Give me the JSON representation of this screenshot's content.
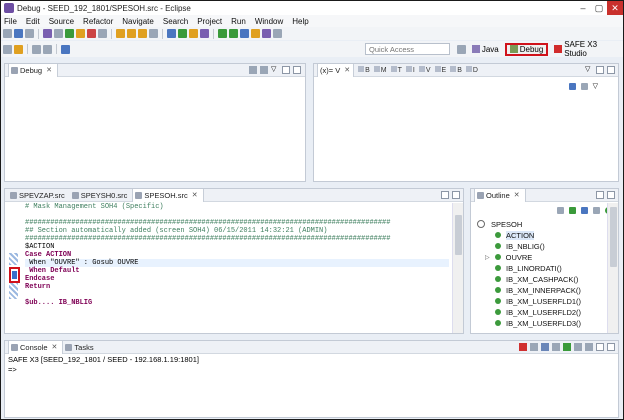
{
  "window": {
    "title": "Debug - SEED_192_1801/SPESOH.src - Eclipse"
  },
  "menu": [
    "File",
    "Edit",
    "Source",
    "Refactor",
    "Navigate",
    "Search",
    "Project",
    "Run",
    "Window",
    "Help"
  ],
  "quick_access": {
    "placeholder": "Quick Access"
  },
  "perspectives": {
    "java": "Java",
    "debug": "Debug",
    "safe": "SAFE X3 Studio"
  },
  "debug_view": {
    "tab": "Debug"
  },
  "variables_view": {
    "tab": "(x)= V",
    "tabs": [
      "B",
      "M",
      "T",
      "I",
      "V",
      "E",
      "B",
      "D"
    ]
  },
  "editor": {
    "tabs": [
      "SPEVZAP.src",
      "SPEYSH0.src",
      "SPESOH.src"
    ],
    "active_tab": "SPESOH.src",
    "lines": [
      {
        "text": "# Mask Management SOH4 (Specific)",
        "style": "comment"
      },
      {
        "text": "",
        "style": ""
      },
      {
        "text": "#######################################################################################",
        "style": "comment"
      },
      {
        "text": "## Section automatically added (screen SOH4) 06/15/2011 14:32:21 (ADMIN)",
        "style": "comment"
      },
      {
        "text": "#######################################################################################",
        "style": "comment"
      },
      {
        "text": "$ACTION",
        "style": ""
      },
      {
        "text": "Case ACTION",
        "style": "kw"
      },
      {
        "text": " When \"OUVRE\" : Gosub OUVRE",
        "style": "hl"
      },
      {
        "text": " When Default",
        "style": "kw"
      },
      {
        "text": "Endcase",
        "style": "kw"
      },
      {
        "text": "Return",
        "style": "kw"
      },
      {
        "text": "",
        "style": ""
      },
      {
        "text": "$ub.... IB_NBLIG",
        "style": "kw"
      }
    ]
  },
  "outline": {
    "tab": "Outline",
    "root": "SPESOH",
    "items": [
      "ACTION",
      "IB_NBLIG()",
      "OUVRE",
      "IB_LINORDATI()",
      "IB_XM_CASHPACK()",
      "IB_XM_INNERPACK()",
      "IB_XM_LUSERFLD1()",
      "IB_XM_LUSERFLD2()",
      "IB_XM_LUSERFLD3()"
    ]
  },
  "console": {
    "tabs": [
      "Console",
      "Tasks"
    ],
    "header": "SAFE X3 [SEED_192_1801 / SEED - 192.168.1.19:1801]",
    "prompt": "=>"
  }
}
